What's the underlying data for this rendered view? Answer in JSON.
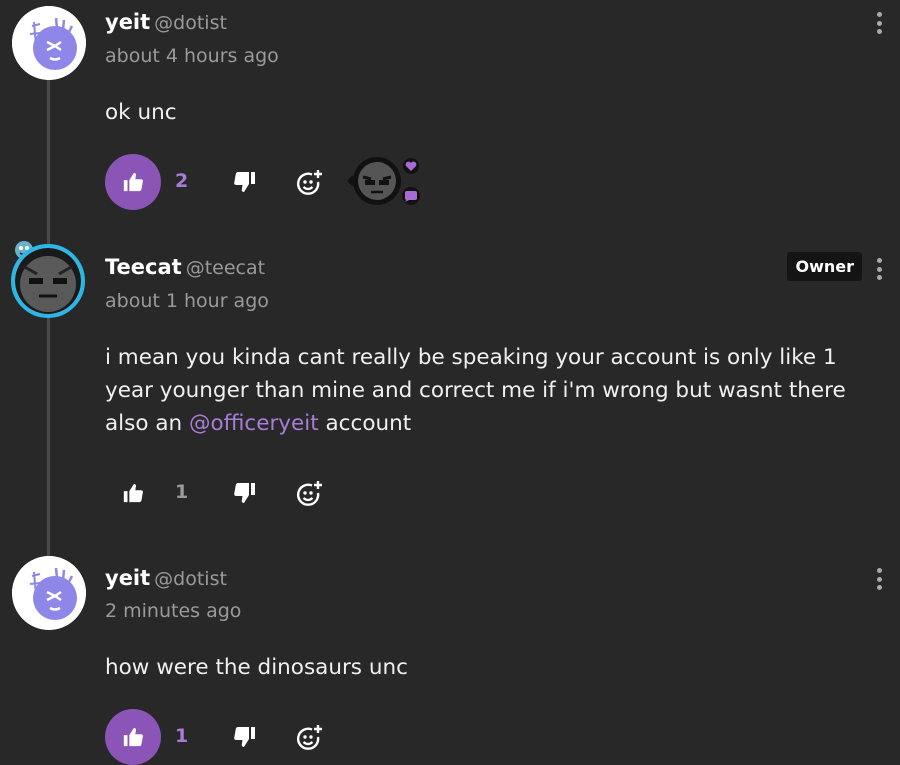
{
  "comments": [
    {
      "username": "yeit",
      "handle": "@dotist",
      "time": "about 4 hours ago",
      "text": "ok unc",
      "likes": "2",
      "liked": true
    },
    {
      "username": "Teecat",
      "handle": "@teecat",
      "badge": "Owner",
      "time": "about 1 hour ago",
      "text_before": "i mean you kinda cant really be speaking your account is only like 1 year younger than mine and correct me if i'm wrong but wasnt there also an",
      "mention": "@officeryeit",
      "text_after": " account",
      "likes": "1",
      "liked": false
    },
    {
      "username": "yeit",
      "handle": "@dotist",
      "time": "2 minutes ago",
      "text": "how were the dinosaurs unc",
      "likes": "1",
      "liked": true
    }
  ],
  "colors": {
    "accent": "#8b55b8",
    "mention": "#a77dd6",
    "ring": "#2ab8e8",
    "background": "#282828"
  },
  "icons": [
    "thumbs-up-icon",
    "thumbs-down-icon",
    "add-reaction-icon",
    "more-options-icon",
    "heart-icon",
    "chat-bubble-icon"
  ]
}
